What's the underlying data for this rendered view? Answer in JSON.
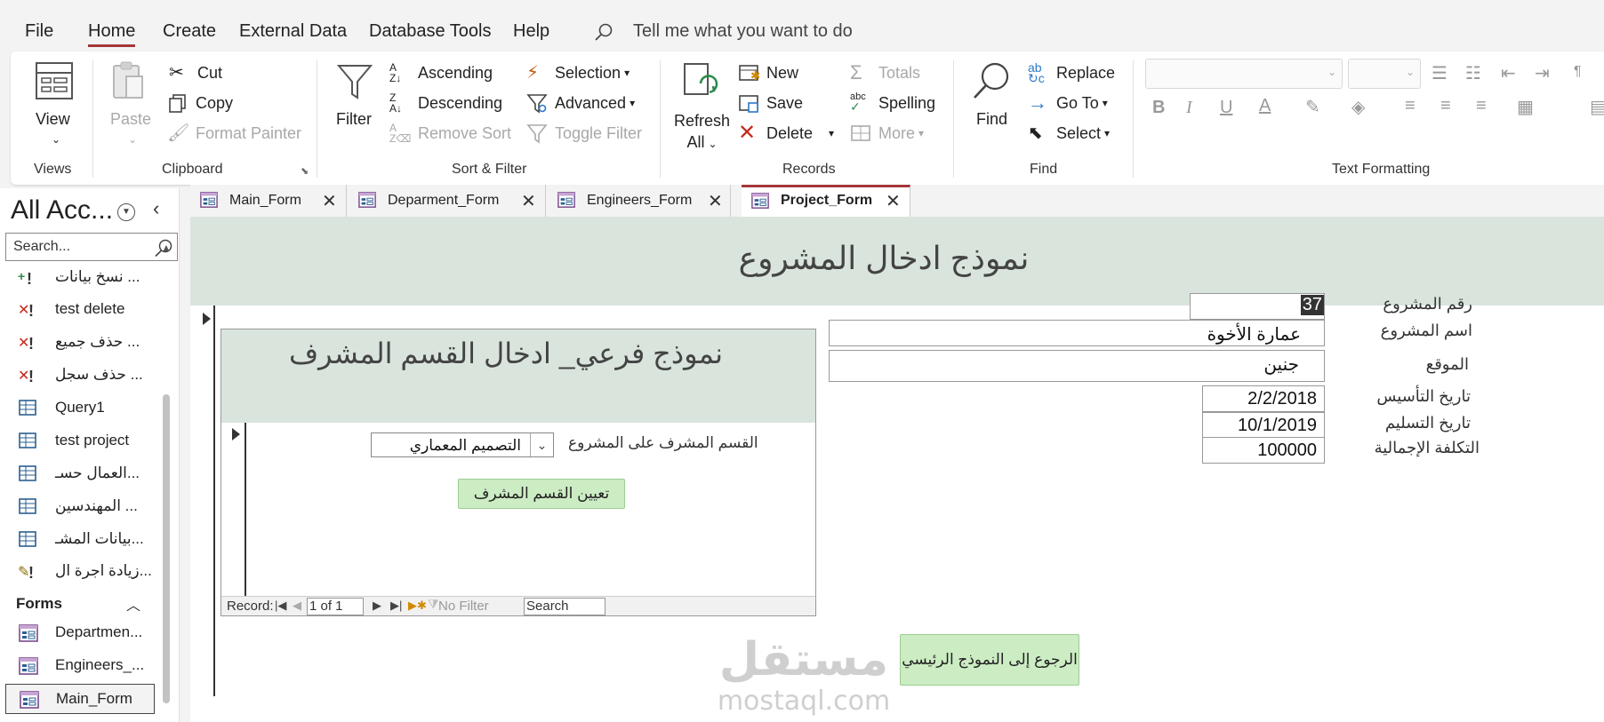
{
  "menubar": {
    "items": [
      "File",
      "Home",
      "Create",
      "External Data",
      "Database Tools",
      "Help"
    ],
    "active": "Home",
    "tellme": "Tell me what you want to do"
  },
  "ribbon": {
    "views": {
      "view_label": "View",
      "group": "Views"
    },
    "clipboard": {
      "paste": "Paste",
      "cut": "Cut",
      "copy": "Copy",
      "format_painter": "Format Painter",
      "group": "Clipboard"
    },
    "sort_filter": {
      "filter": "Filter",
      "ascending": "Ascending",
      "descending": "Descending",
      "remove_sort": "Remove Sort",
      "selection": "Selection",
      "advanced": "Advanced",
      "toggle_filter": "Toggle Filter",
      "group": "Sort & Filter"
    },
    "records": {
      "refresh_line1": "Refresh",
      "refresh_line2": "All",
      "new": "New",
      "save": "Save",
      "delete": "Delete",
      "totals": "Totals",
      "spelling": "Spelling",
      "more": "More",
      "group": "Records"
    },
    "find": {
      "find": "Find",
      "replace": "Replace",
      "goto": "Go To",
      "select": "Select",
      "group": "Find"
    },
    "text_formatting": {
      "group": "Text Formatting"
    }
  },
  "navpane": {
    "title": "All Acc...",
    "search_placeholder": "Search...",
    "items": [
      {
        "label": "نسخ بيانات ...",
        "icon": "append-query-icon"
      },
      {
        "label": "test delete",
        "icon": "delete-query-icon"
      },
      {
        "label": "حذف جميع ...",
        "icon": "delete-query-icon"
      },
      {
        "label": "حذف سجل ...",
        "icon": "delete-query-icon"
      },
      {
        "label": "Query1",
        "icon": "select-query-icon"
      },
      {
        "label": "test project",
        "icon": "select-query-icon"
      },
      {
        "label": "العمال حسـ...",
        "icon": "select-query-icon"
      },
      {
        "label": "المهندسين ...",
        "icon": "select-query-icon"
      },
      {
        "label": "بيانات المشـ...",
        "icon": "select-query-icon"
      },
      {
        "label": "زيادة اجرة ال...",
        "icon": "update-query-icon"
      }
    ],
    "forms_header": "Forms",
    "forms": [
      {
        "label": "Departmen..."
      },
      {
        "label": "Engineers_..."
      },
      {
        "label": "Main_Form",
        "selected": true
      }
    ]
  },
  "tabs": [
    {
      "label": "Main_Form"
    },
    {
      "label": "Deparment_Form"
    },
    {
      "label": "Engineers_Form"
    },
    {
      "label": "Project_Form",
      "active": true
    }
  ],
  "form": {
    "title": "نموذج ادخال المشروع",
    "fields": {
      "project_id": {
        "label": "رقم المشروع",
        "value": "37"
      },
      "project_name": {
        "label": "اسم المشروع",
        "value": "عمارة الأخوة"
      },
      "location": {
        "label": "الموقع",
        "value": "جنين"
      },
      "founded": {
        "label": "تاريخ التأسيس",
        "value": "2/2/2018"
      },
      "delivery": {
        "label": "تاريخ التسليم",
        "value": "10/1/2019"
      },
      "total_cost": {
        "label": "التكلفة الإجمالية",
        "value": "100000"
      }
    },
    "back_button": "الرجوع إلى النموذج الرئيسي",
    "subform": {
      "title": "نموذج فرعي_ ادخال القسم المشرف",
      "dept_label": "القسم المشرف على المشروع",
      "dept_value": "التصميم المعماري",
      "assign_button": "تعيين القسم المشرف",
      "navbar": {
        "record_label": "Record:",
        "position": "1 of 1",
        "no_filter": "No Filter",
        "search": "Search"
      }
    },
    "watermark": {
      "arabic": "مستقل",
      "latin": "mostaql.com"
    }
  },
  "colors": {
    "accent": "#a4373a",
    "form_header": "#d9e4dd",
    "button_green": "#ccecc3"
  }
}
